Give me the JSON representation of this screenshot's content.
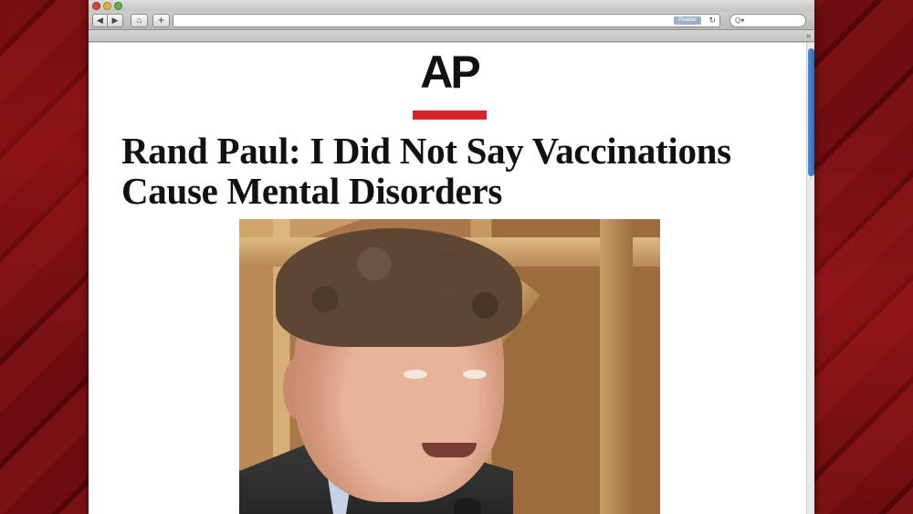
{
  "browser": {
    "toolbar": {
      "back_glyph": "◀",
      "forward_glyph": "▶",
      "home_glyph": "⌂",
      "add_glyph": "+",
      "reader_label": "Reader",
      "reload_glyph": "↻",
      "search_glyph": "Q▾",
      "bookmarks_overflow_glyph": "»"
    }
  },
  "article": {
    "logo_text": "AP",
    "logo_accent_color": "#d4262c",
    "headline": "Rand Paul: I Did Not Say Vaccinations Cause Mental Disorders"
  },
  "backdrop_color": "#5a0a0c"
}
